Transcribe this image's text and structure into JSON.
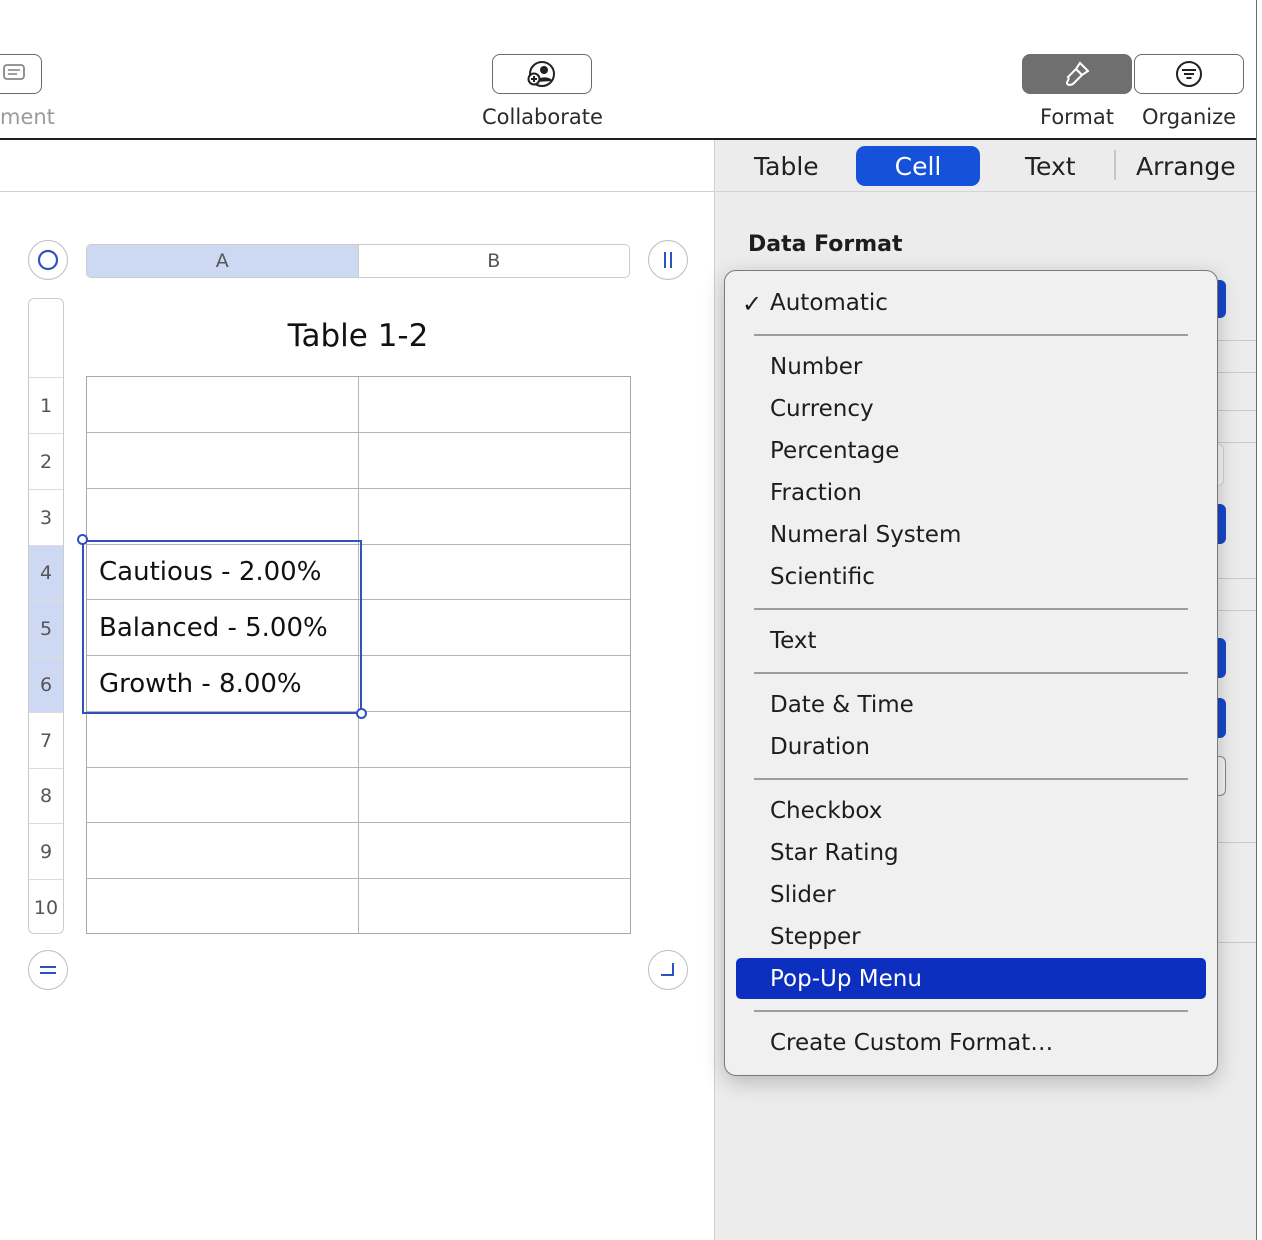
{
  "toolbar": {
    "comment_label": "ment",
    "collaborate_label": "Collaborate",
    "format_label": "Format",
    "organize_label": "Organize"
  },
  "sheet": {
    "table_title": "Table 1-2",
    "columns": [
      "A",
      "B"
    ],
    "rows": [
      "1",
      "2",
      "3",
      "4",
      "5",
      "6",
      "7",
      "8",
      "9",
      "10"
    ],
    "cells": {
      "r4": "Cautious - 2.00%",
      "r5": "Balanced - 5.00%",
      "r6": "Growth - 8.00%"
    },
    "selected_rows": [
      4,
      5,
      6
    ],
    "selected_column": "A"
  },
  "inspector": {
    "tabs": [
      "Table",
      "Cell",
      "Text",
      "Arrange"
    ],
    "active_tab": "Cell",
    "section_label": "Data Format"
  },
  "data_format_menu": {
    "checked": "Automatic",
    "highlighted": "Pop-Up Menu",
    "items": {
      "automatic": "Automatic",
      "number": "Number",
      "currency": "Currency",
      "percentage": "Percentage",
      "fraction": "Fraction",
      "numeral_system": "Numeral System",
      "scientific": "Scientific",
      "text": "Text",
      "date_time": "Date & Time",
      "duration": "Duration",
      "checkbox": "Checkbox",
      "star_rating": "Star Rating",
      "slider": "Slider",
      "stepper": "Stepper",
      "popup_menu": "Pop-Up Menu",
      "custom": "Create Custom Format…"
    }
  },
  "colors": {
    "accent": "#1652d9",
    "menu_highlight": "#0c2fbf",
    "selection": "#2f52c0",
    "header_selected": "#cdd9f2"
  }
}
